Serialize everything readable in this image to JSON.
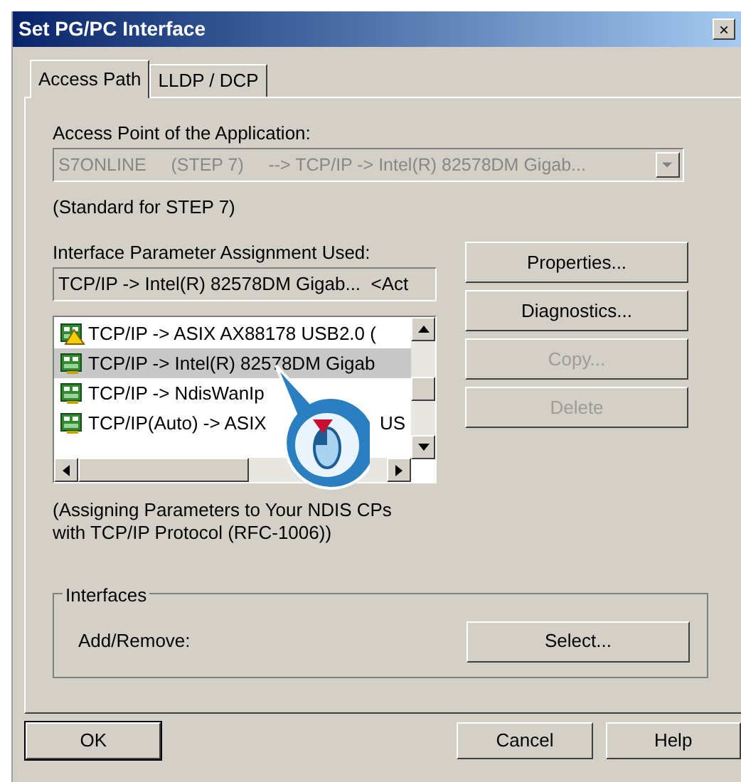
{
  "window": {
    "title": "Set PG/PC Interface",
    "close": "×"
  },
  "tabs": [
    {
      "label": "Access Path",
      "selected": true
    },
    {
      "label": "LLDP / DCP",
      "selected": false
    }
  ],
  "access_point": {
    "label": "Access Point of the Application:",
    "value": "S7ONLINE     (STEP 7)     --> TCP/IP -> Intel(R) 82578DM Gigab...",
    "disabled": true,
    "note": "(Standard for STEP 7)"
  },
  "interface_assignment": {
    "label": "Interface Parameter Assignment Used:",
    "value": "TCP/IP -> Intel(R) 82578DM Gigab...  <Act",
    "items": [
      {
        "text": "TCP/IP -> ASIX AX88178 USB2.0 (",
        "warning": true,
        "selected": false
      },
      {
        "text": "TCP/IP -> Intel(R) 82578DM Gigab",
        "warning": false,
        "selected": true
      },
      {
        "text": "TCP/IP -> NdisWanIp",
        "warning": false,
        "selected": false
      },
      {
        "text": "TCP/IP(Auto) -> ASIX",
        "text_tail": "US",
        "warning": false,
        "selected": false
      }
    ],
    "description": "(Assigning Parameters to Your NDIS CPs with TCP/IP Protocol (RFC-1006))"
  },
  "side_buttons": [
    {
      "label": "Properties...",
      "disabled": false
    },
    {
      "label": "Diagnostics...",
      "disabled": false
    },
    {
      "label": "Copy...",
      "disabled": true
    },
    {
      "label": "Delete",
      "disabled": true
    }
  ],
  "interfaces": {
    "title": "Interfaces",
    "label": "Add/Remove:",
    "button": "Select..."
  },
  "buttons": [
    {
      "label": "OK",
      "default": true
    },
    {
      "label": "Cancel",
      "default": false
    },
    {
      "label": "Help",
      "default": false
    }
  ]
}
